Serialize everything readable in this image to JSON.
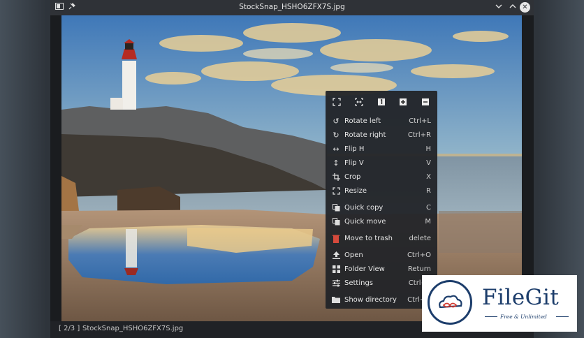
{
  "window": {
    "title": "StockSnap_HSHO6ZFX7S.jpg",
    "left_icons": [
      "windows-icon",
      "pin-icon"
    ],
    "controls": [
      "minimize-icon",
      "maximize-icon",
      "close-icon"
    ]
  },
  "status": {
    "position": "[ 2/3 ]",
    "filename": "StockSnap_HSHO6ZFX7S.jpg"
  },
  "menu": {
    "top_icons": [
      "fit-window-icon",
      "fit-width-icon",
      "original-size-icon",
      "zoom-in-icon",
      "zoom-out-icon"
    ],
    "items": [
      {
        "label": "Rotate left",
        "shortcut": "Ctrl+L",
        "icon": "rotate-left-icon"
      },
      {
        "label": "Rotate right",
        "shortcut": "Ctrl+R",
        "icon": "rotate-right-icon"
      },
      {
        "label": "Flip H",
        "shortcut": "H",
        "icon": "flip-h-icon"
      },
      {
        "label": "Flip V",
        "shortcut": "V",
        "icon": "flip-v-icon"
      },
      {
        "label": "Crop",
        "shortcut": "X",
        "icon": "crop-icon"
      },
      {
        "label": "Resize",
        "shortcut": "R",
        "icon": "resize-icon"
      },
      {
        "label": "Quick copy",
        "shortcut": "C",
        "icon": "copy-icon"
      },
      {
        "label": "Quick move",
        "shortcut": "M",
        "icon": "move-icon"
      },
      {
        "label": "Move to trash",
        "shortcut": "delete",
        "icon": "trash-icon"
      },
      {
        "label": "Open",
        "shortcut": "Ctrl+O",
        "icon": "open-icon"
      },
      {
        "label": "Folder View",
        "shortcut": "Return",
        "icon": "folder-view-icon"
      },
      {
        "label": "Settings",
        "shortcut": "Ctrl+P",
        "icon": "settings-icon"
      },
      {
        "label": "Show directory",
        "shortcut": "Ctrl+D",
        "icon": "folder-icon"
      }
    ]
  },
  "watermark": {
    "brand": "FileGit",
    "tagline": "Free & Unlimited"
  }
}
